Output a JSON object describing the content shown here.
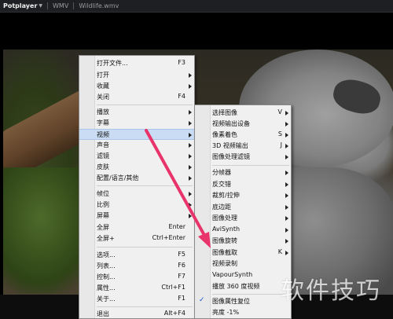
{
  "titlebar": {
    "app": "Potplayer",
    "items": [
      "WMV",
      "Wildlife.wmv"
    ]
  },
  "menu_left": [
    {
      "label": "打开文件...",
      "shortcut": "F3"
    },
    {
      "label": "打开",
      "submenu": true
    },
    {
      "label": "收藏",
      "submenu": true
    },
    {
      "label": "关闭",
      "shortcut": "F4"
    },
    {
      "label": "播放",
      "submenu": true
    },
    {
      "label": "字幕",
      "submenu": true
    },
    {
      "label": "视频",
      "submenu": true
    },
    {
      "label": "声音",
      "submenu": true
    },
    {
      "label": "滤镜",
      "submenu": true
    },
    {
      "label": "皮肤",
      "submenu": true
    },
    {
      "label": "配置/语言/其他",
      "submenu": true
    },
    {
      "label": "帧位",
      "submenu": true
    },
    {
      "label": "比例",
      "submenu": true
    },
    {
      "label": "屏幕",
      "submenu": true
    },
    {
      "label": "全屏",
      "shortcut": "Enter"
    },
    {
      "label": "全屏+",
      "shortcut": "Ctrl+Enter"
    },
    {
      "label": "选项...",
      "shortcut": "F5"
    },
    {
      "label": "列表...",
      "shortcut": "F6"
    },
    {
      "label": "控制...",
      "shortcut": "F7"
    },
    {
      "label": "属性...",
      "shortcut": "Ctrl+F1"
    },
    {
      "label": "关于...",
      "shortcut": "F1"
    },
    {
      "label": "退出",
      "shortcut": "Alt+F4"
    }
  ],
  "menu_right": [
    {
      "label": "选择图像",
      "shortcut": "V"
    },
    {
      "label": "视频输出设备",
      "submenu": true
    },
    {
      "label": "像素着色",
      "shortcut": "S"
    },
    {
      "label": "3D 视频输出",
      "shortcut": "J"
    },
    {
      "label": "图像处理滤镜",
      "submenu": true
    },
    {
      "label": "分帧器",
      "submenu": true
    },
    {
      "label": "反交错",
      "submenu": true
    },
    {
      "label": "裁剪/拉伸",
      "submenu": true
    },
    {
      "label": "底边距",
      "submenu": true
    },
    {
      "label": "图像处理",
      "submenu": true
    },
    {
      "label": "AviSynth",
      "submenu": true
    },
    {
      "label": "图像旋转",
      "submenu": true
    },
    {
      "label": "图像截取",
      "shortcut": "K"
    },
    {
      "label": "视频录制"
    },
    {
      "label": "VapourSynth"
    },
    {
      "label": "播放 360 度视频"
    },
    {
      "label": "图像属性复位"
    },
    {
      "label": "亮度 -1%"
    }
  ],
  "watermark": "软件技巧",
  "colors": {
    "menu_bg": "#f0f0f0",
    "highlight": "#c9dcf3",
    "annotation_arrow": "#e8336b"
  }
}
